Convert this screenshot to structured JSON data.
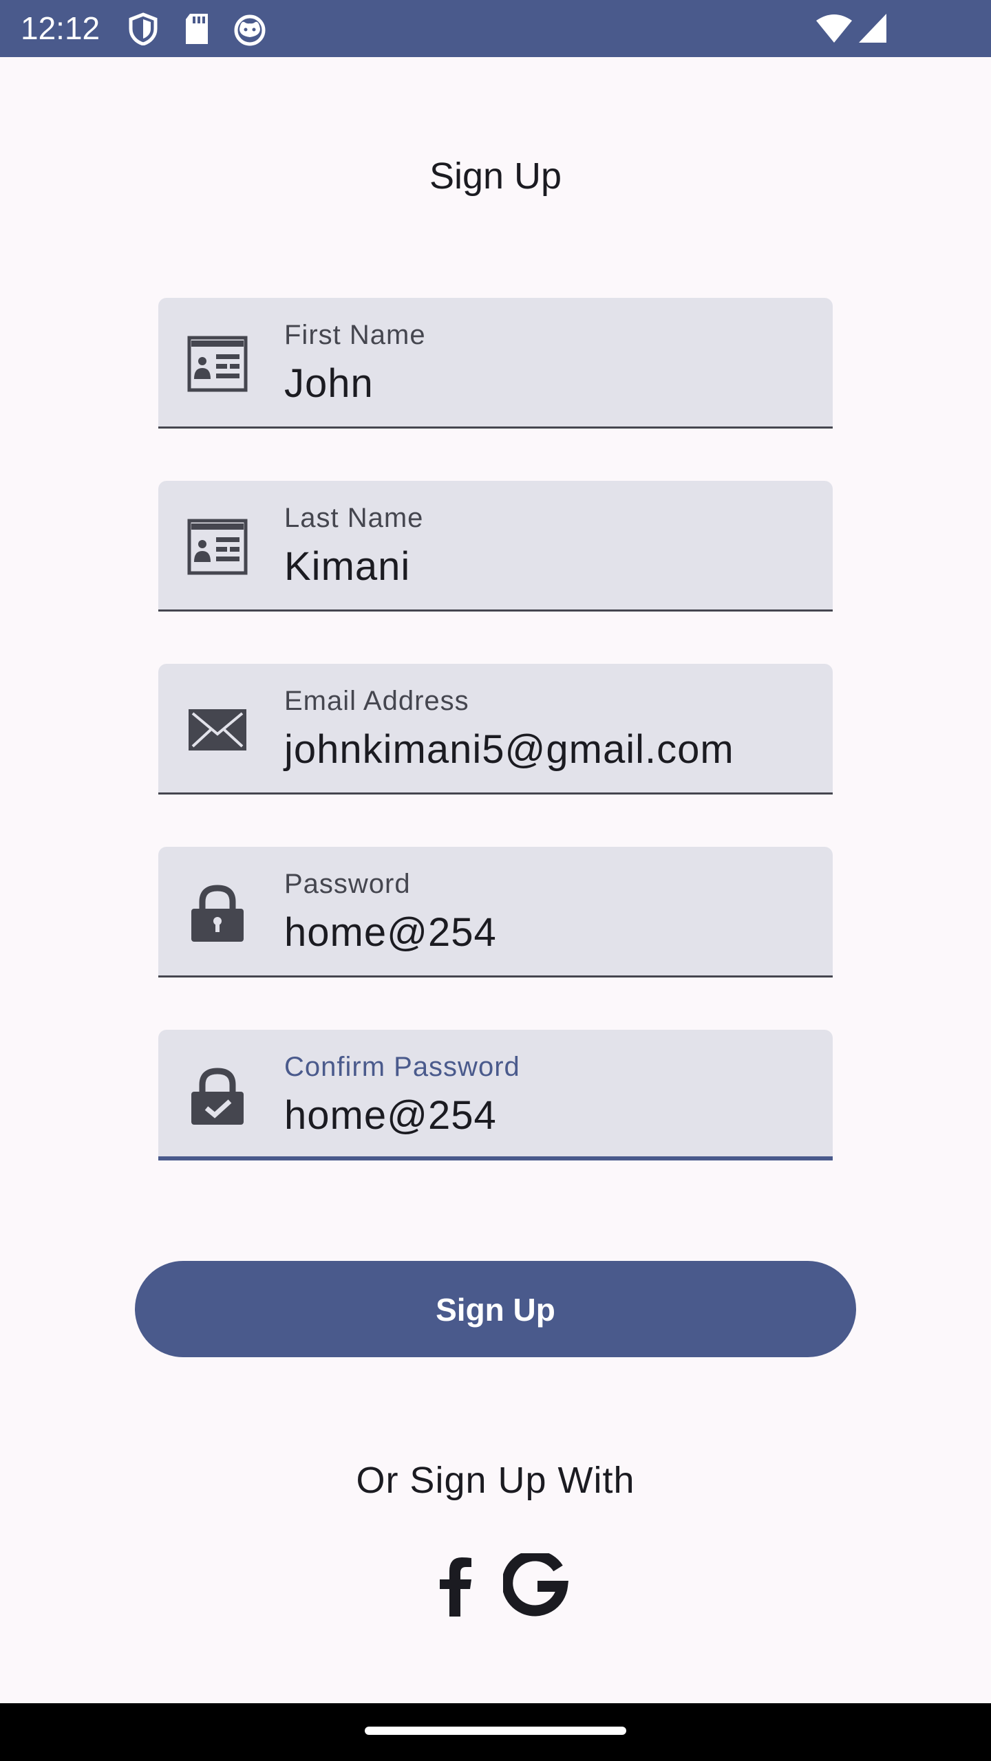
{
  "status_bar": {
    "time": "12:12",
    "icons": [
      "shield-icon",
      "sd-card-icon",
      "cat-face-icon",
      "wifi-icon",
      "cellular-signal-icon"
    ],
    "background": "#4a5a8c"
  },
  "page": {
    "title": "Sign Up"
  },
  "fields": [
    {
      "label": "First Name",
      "value": "John",
      "icon": "id-card-icon"
    },
    {
      "label": "Last Name",
      "value": "Kimani",
      "icon": "id-card-icon"
    },
    {
      "label": "Email Address",
      "value": "johnkimani5@gmail.com",
      "icon": "envelope-icon"
    },
    {
      "label": "Password",
      "value": "home@254",
      "icon": "lock-icon"
    },
    {
      "label": "Confirm Password",
      "value": "home@254",
      "icon": "lock-check-icon",
      "focused": true
    }
  ],
  "actions": {
    "signup_label": "Sign Up",
    "alt_signup_text": "Or Sign Up With",
    "social": [
      "facebook-icon",
      "google-icon"
    ]
  },
  "colors": {
    "accent": "#4a5a8c",
    "field_bg": "#e2e2ea",
    "page_bg": "#fcf8fb"
  }
}
